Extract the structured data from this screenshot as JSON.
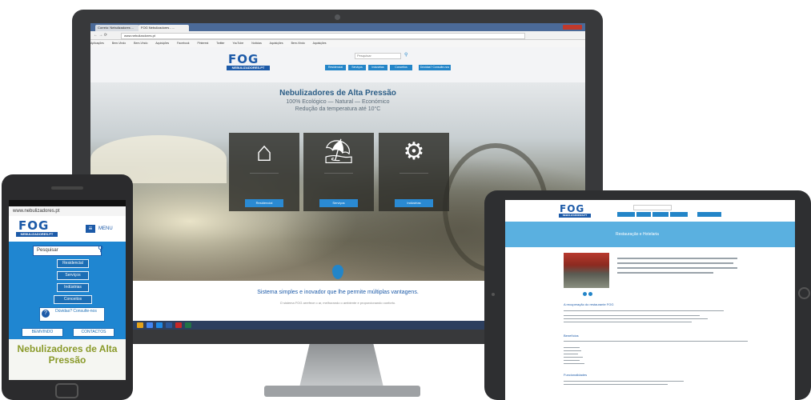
{
  "browser": {
    "tabs": [
      "Correio: Nebulizadores ...",
      "FOG Nebulizadores - ..."
    ],
    "url": "www.nebulizadores.pt",
    "bookmarks": [
      "Aplicações",
      "Bem-Vindo",
      "Bem-Vindo",
      "Aquisições",
      "Facebook",
      "Pinterest",
      "Twitter",
      "YouTube",
      "Notícias",
      "Aquisições",
      "Bem-Vindo",
      "Aquisições"
    ]
  },
  "site": {
    "logo_main": "FOG",
    "logo_sub": "NEBULIZADORES.PT",
    "search_placeholder": "Pesquisar",
    "nav": [
      "Residencial",
      "Serviços",
      "Industrias",
      "Conceitos",
      "Dúvidas? Consulte-nos"
    ],
    "hero_title": "Nebulizadores de Alta Pressão",
    "hero_lines": [
      "100% Ecológico — Natural — Económico",
      "Redução da temperatura até 10°C"
    ],
    "cards": [
      {
        "icon": "house-icon",
        "button": "Residencial"
      },
      {
        "icon": "patio-table-icon",
        "button": "Serviços"
      },
      {
        "icon": "gears-icon",
        "button": "Indústrias"
      }
    ],
    "band_title": "Sistema simples e inovador que lhe permite múltiplas vantagens.",
    "band_text": "O sistema FOG arrefece o ar, melhorando o ambiente e proporcionando conforto."
  },
  "phone": {
    "url": "www.nebulizadores.pt",
    "logo_main": "FOG",
    "logo_sub": "NEBULIZADORES.PT",
    "menu": "MENU",
    "search": "Pesquisar",
    "items": [
      "Residencial",
      "Serviços",
      "Indústrias",
      "Conceitos"
    ],
    "help": "Dúvidas? Consulte-nos",
    "buttons": [
      "BEMVINDO",
      "CONTACTOS"
    ],
    "title": "Nebulizadores de Alta Pressão"
  },
  "tablet": {
    "logo_main": "FOG",
    "logo_sub": "NEBULIZADORES.PT",
    "banner": "Restauração e Hotelaria",
    "section_1": "A recuperação do restaurante FOG",
    "section_2": "Benefícios",
    "section_3": "Funcionalidades"
  },
  "colors": {
    "brand_blue": "#1c5aa8",
    "button_blue": "#2385c8",
    "device_dark": "#38393b"
  }
}
